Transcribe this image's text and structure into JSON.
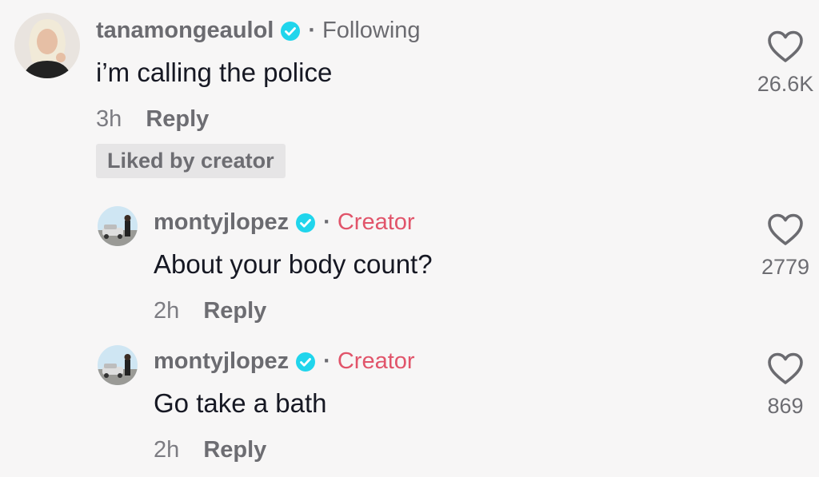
{
  "colors": {
    "background": "#f7f6f6",
    "verified_badge": "#20d5ec",
    "creator_tag": "#e1546a",
    "muted_text": "#6b6b70"
  },
  "icons": {
    "verified": "verified-check-icon",
    "like": "heart-outline-icon"
  },
  "comments": [
    {
      "username": "tanamongeaulol",
      "separator": "·",
      "tag": "Following",
      "text": "i’m calling the police",
      "time": "3h",
      "reply_label": "Reply",
      "liked_badge": "Liked by creator",
      "like_count": "26.6K"
    },
    {
      "username": "montyjlopez",
      "separator": "·",
      "tag": "Creator",
      "text": "About your body count?",
      "time": "2h",
      "reply_label": "Reply",
      "like_count": "2779"
    },
    {
      "username": "montyjlopez",
      "separator": "·",
      "tag": "Creator",
      "text": "Go take a bath",
      "time": "2h",
      "reply_label": "Reply",
      "like_count": "869"
    }
  ]
}
